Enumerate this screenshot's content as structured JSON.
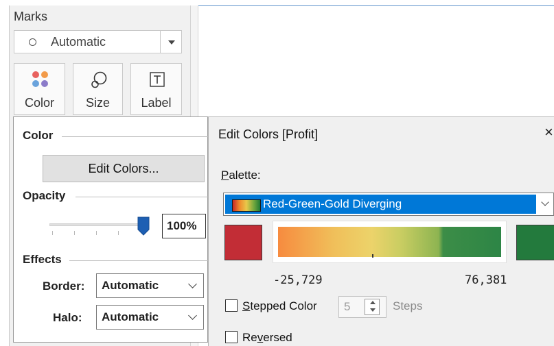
{
  "marks": {
    "title": "Marks",
    "mark_type": "Automatic",
    "buttons": [
      {
        "label": "Color",
        "icon": "color-dots-icon"
      },
      {
        "label": "Size",
        "icon": "size-icon"
      },
      {
        "label": "Label",
        "icon": "label-icon"
      }
    ]
  },
  "color_popup": {
    "color_section": "Color",
    "edit_colors_label": "Edit Colors...",
    "opacity_section": "Opacity",
    "opacity_value": "100%",
    "opacity_fraction": 1.0,
    "effects_section": "Effects",
    "border_label": "Border:",
    "border_value": "Automatic",
    "halo_label": "Halo:",
    "halo_value": "Automatic"
  },
  "dialog": {
    "title": "Edit Colors [Profit]",
    "close_glyph": "×",
    "palette_label": "Palette:",
    "palette_label_mnemonic": "P",
    "palette_label_rest": "alette:",
    "palette_value": "Red-Green-Gold Diverging",
    "start_color": "#c22d36",
    "end_color": "#237a3d",
    "range_min": "-25,729",
    "range_max": "76,381",
    "stepped_label_mnemonic": "S",
    "stepped_label_rest": "tepped Color",
    "stepped_checked": false,
    "steps_value": "5",
    "steps_label": "Steps",
    "reversed_label_pre": "Re",
    "reversed_label_mnemonic": "v",
    "reversed_label_post": "ersed",
    "reversed_checked": false
  },
  "colors": {
    "selection_blue": "#0078d7",
    "slider_thumb": "#1d5fb3"
  }
}
